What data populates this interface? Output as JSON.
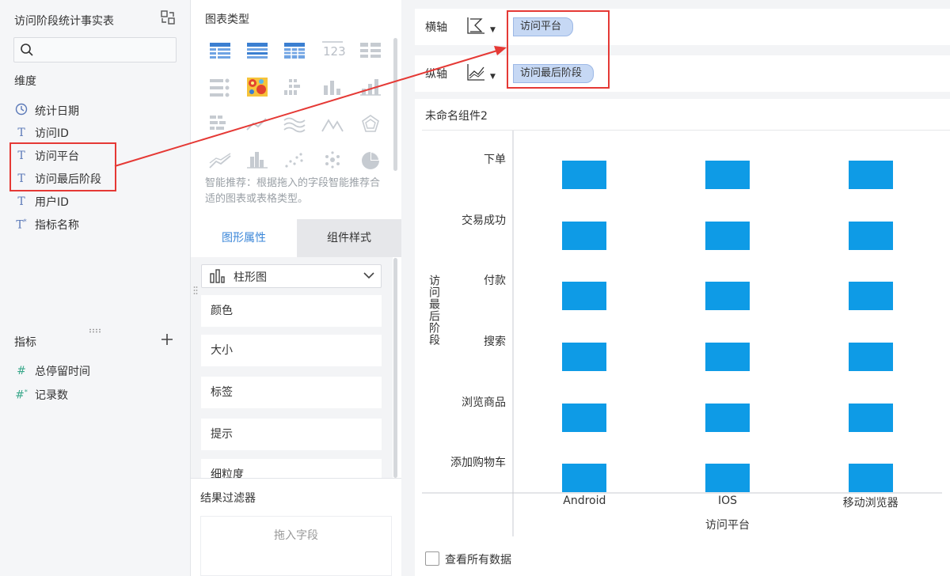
{
  "left_panel": {
    "title": "访问阶段统计事实表",
    "search": {
      "placeholder": ""
    },
    "dimensions_heading": "维度",
    "dimensions": [
      {
        "type": "date",
        "icon": "clock-icon",
        "label": "统计日期"
      },
      {
        "type": "text",
        "icon": "text-type-icon",
        "label": "访问ID"
      },
      {
        "type": "text",
        "icon": "text-type-icon",
        "label": "访问平台"
      },
      {
        "type": "text",
        "icon": "text-type-icon",
        "label": "访问最后阶段"
      },
      {
        "type": "text",
        "icon": "text-type-icon",
        "label": "用户ID"
      },
      {
        "type": "text-calc",
        "icon": "text-calc-type-icon",
        "label": "指标名称"
      }
    ],
    "measures_heading": "指标",
    "measures": [
      {
        "icon": "number-type-icon",
        "label": "总停留时间"
      },
      {
        "icon": "number-calc-type-icon",
        "label": "记录数"
      }
    ]
  },
  "middle_panel": {
    "chart_types_title": "图表类型",
    "hint": "智能推荐：根据拖入的字段智能推荐合适的图表或表格类型。",
    "tabs": [
      "图形属性",
      "组件样式"
    ],
    "active_tab": "图形属性",
    "chart_type_select": "柱形图",
    "properties": [
      "颜色",
      "大小",
      "标签",
      "提示",
      "细粒度"
    ],
    "result_filter_title": "结果过滤器",
    "drop_placeholder": "拖入字段"
  },
  "axis_shelf": {
    "x_label": "横轴",
    "x_field": "访问平台",
    "y_label": "纵轴",
    "y_field": "访问最后阶段"
  },
  "chart_card": {
    "title": "未命名组件2",
    "show_all_label": "查看所有数据",
    "show_all_checked": false
  },
  "colors": {
    "bar": "#0e9be6",
    "accent": "#3a86d8",
    "highlight": "#e53935"
  },
  "chart_data": {
    "type": "heatmap",
    "x_categories": [
      "Android",
      "IOS",
      "移动浏览器"
    ],
    "y_categories": [
      "下单",
      "交易成功",
      "付款",
      "搜索",
      "浏览商品",
      "添加购物车"
    ],
    "xlabel": "访问平台",
    "ylabel": "访问最后阶段",
    "cells_present": [
      [
        1,
        1,
        1
      ],
      [
        1,
        1,
        1
      ],
      [
        1,
        1,
        1
      ],
      [
        1,
        1,
        1
      ],
      [
        1,
        1,
        1
      ],
      [
        1,
        1,
        1
      ]
    ]
  }
}
